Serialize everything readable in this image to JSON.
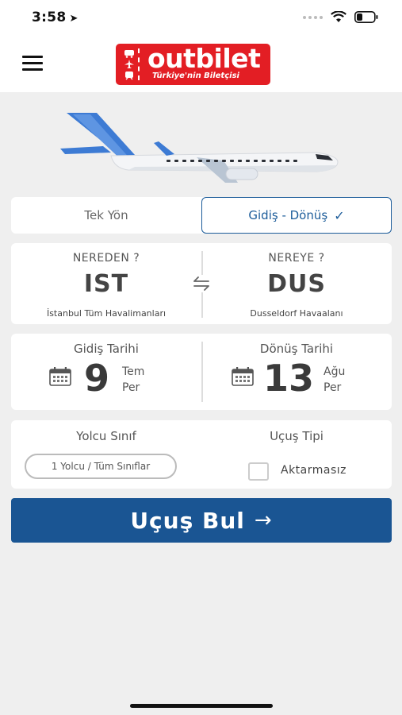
{
  "status": {
    "time": "3:58",
    "location_glyph": "➤"
  },
  "header": {
    "menu_icon": "hamburger-icon",
    "logo_name": "outbilet",
    "logo_tagline": "Türkiye'nin Biletçisi",
    "brand_color": "#e31e24"
  },
  "trip_type": {
    "one_way_label": "Tek Yön",
    "round_trip_label": "Gidiş - Dönüş",
    "round_trip_check": "✓",
    "selected": "round_trip",
    "accent_color": "#1c5c9a"
  },
  "route": {
    "from_label": "NEREDEN ?",
    "from_code": "IST",
    "from_name": "İstanbul Tüm Havalimanları",
    "to_label": "NEREYE ?",
    "to_code": "DUS",
    "to_name": "Dusseldorf Havaalanı",
    "swap_icon": "swap-arrows-icon"
  },
  "dates": {
    "departure_label": "Gidiş Tarihi",
    "departure_day": "9",
    "departure_month": "Tem",
    "departure_weekday": "Per",
    "return_label": "Dönüş Tarihi",
    "return_day": "13",
    "return_month": "Ağu",
    "return_weekday": "Per",
    "calendar_icon": "calendar-icon"
  },
  "passengers": {
    "class_label": "Yolcu Sınıf",
    "class_value": "1 Yolcu / Tüm Sınıflar",
    "flight_type_label": "Uçuş Tipi",
    "direct_label": "Aktarmasız",
    "direct_checked": false
  },
  "search_button": {
    "label": "Uçuş Bul",
    "arrow": "→",
    "color": "#1a5593"
  }
}
